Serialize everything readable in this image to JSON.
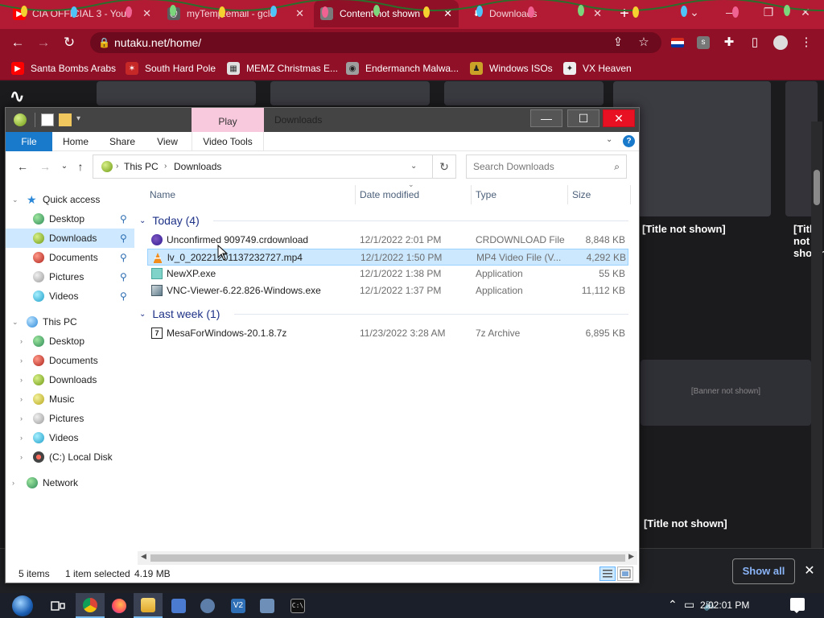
{
  "browser": {
    "tabs": [
      {
        "label": "CIA OFFICIAL 3 - YouT",
        "icon": "youtube-icon",
        "active": false
      },
      {
        "label": "myTemp.email - gclo",
        "icon": "email-icon",
        "active": false
      },
      {
        "label": "Content not shown",
        "icon": "site-icon",
        "active": true
      },
      {
        "label": "Downloads",
        "icon": "download-icon",
        "active": false
      }
    ],
    "new_tab": "+",
    "address": "nutaku.net/home/",
    "bookmarks": [
      {
        "label": "Santa Bombs Arabs",
        "icon": "youtube-icon"
      },
      {
        "label": "South Hard Pole",
        "icon": "santa-icon"
      },
      {
        "label": "MEMZ Christmas E...",
        "icon": "image-icon"
      },
      {
        "label": "Endermanch Malwa...",
        "icon": "raccoon-icon"
      },
      {
        "label": "Windows ISOs",
        "icon": "figure-icon"
      },
      {
        "label": "VX Heaven",
        "icon": "vx-icon"
      }
    ],
    "accent": "#b31b34"
  },
  "site": {
    "cards": [
      {
        "title": "[Title not shown]",
        "sub": ""
      },
      {
        "title": "[Title not shown]",
        "sub": ""
      },
      {
        "title": "[Title not shown]",
        "sub": ""
      }
    ],
    "banner_label": "[Banner not shown]"
  },
  "downloads_bar": {
    "show_all": "Show all"
  },
  "explorer": {
    "context_tab": "Play",
    "title": "Downloads",
    "ribbon_tabs": [
      "File",
      "Home",
      "Share",
      "View",
      "Video Tools"
    ],
    "breadcrumb": [
      "This PC",
      "Downloads"
    ],
    "search_placeholder": "Search Downloads",
    "nav": {
      "quick_access": "Quick access",
      "quick_items": [
        "Desktop",
        "Downloads",
        "Documents",
        "Pictures",
        "Videos"
      ],
      "this_pc": "This PC",
      "pc_items": [
        "Desktop",
        "Documents",
        "Downloads",
        "Music",
        "Pictures",
        "Videos",
        "(C:) Local Disk"
      ],
      "network": "Network"
    },
    "columns": [
      "Name",
      "Date modified",
      "Type",
      "Size"
    ],
    "groups": [
      {
        "label": "Today (4)",
        "files": [
          {
            "name": "Unconfirmed 909749.crdownload",
            "date": "12/1/2022 2:01 PM",
            "type": "CRDOWNLOAD File",
            "size": "8,848 KB",
            "icon": "crdownload-icon"
          },
          {
            "name": "lv_0_20221201137232727.mp4",
            "date": "12/1/2022 1:50 PM",
            "type": "MP4 Video File (V...",
            "size": "4,292 KB",
            "icon": "vlc-icon",
            "selected": true
          },
          {
            "name": "NewXP.exe",
            "date": "12/1/2022 1:38 PM",
            "type": "Application",
            "size": "55 KB",
            "icon": "exe-icon"
          },
          {
            "name": "VNC-Viewer-6.22.826-Windows.exe",
            "date": "12/1/2022 1:37 PM",
            "type": "Application",
            "size": "11,112 KB",
            "icon": "installer-icon"
          }
        ]
      },
      {
        "label": "Last week (1)",
        "files": [
          {
            "name": "MesaForWindows-20.1.8.7z",
            "date": "11/23/2022 3:28 AM",
            "type": "7z Archive",
            "size": "6,895 KB",
            "icon": "7z-icon"
          }
        ]
      }
    ],
    "status": {
      "items": "5 items",
      "selected": "1 item selected",
      "size": "4.19 MB"
    }
  },
  "taskbar": {
    "apps": [
      "start-orb",
      "task-view",
      "chrome",
      "firefox",
      "file-explorer",
      "app-1",
      "app-2",
      "app-v2",
      "app-3",
      "cmd"
    ],
    "clock": "2:02:01 PM"
  }
}
